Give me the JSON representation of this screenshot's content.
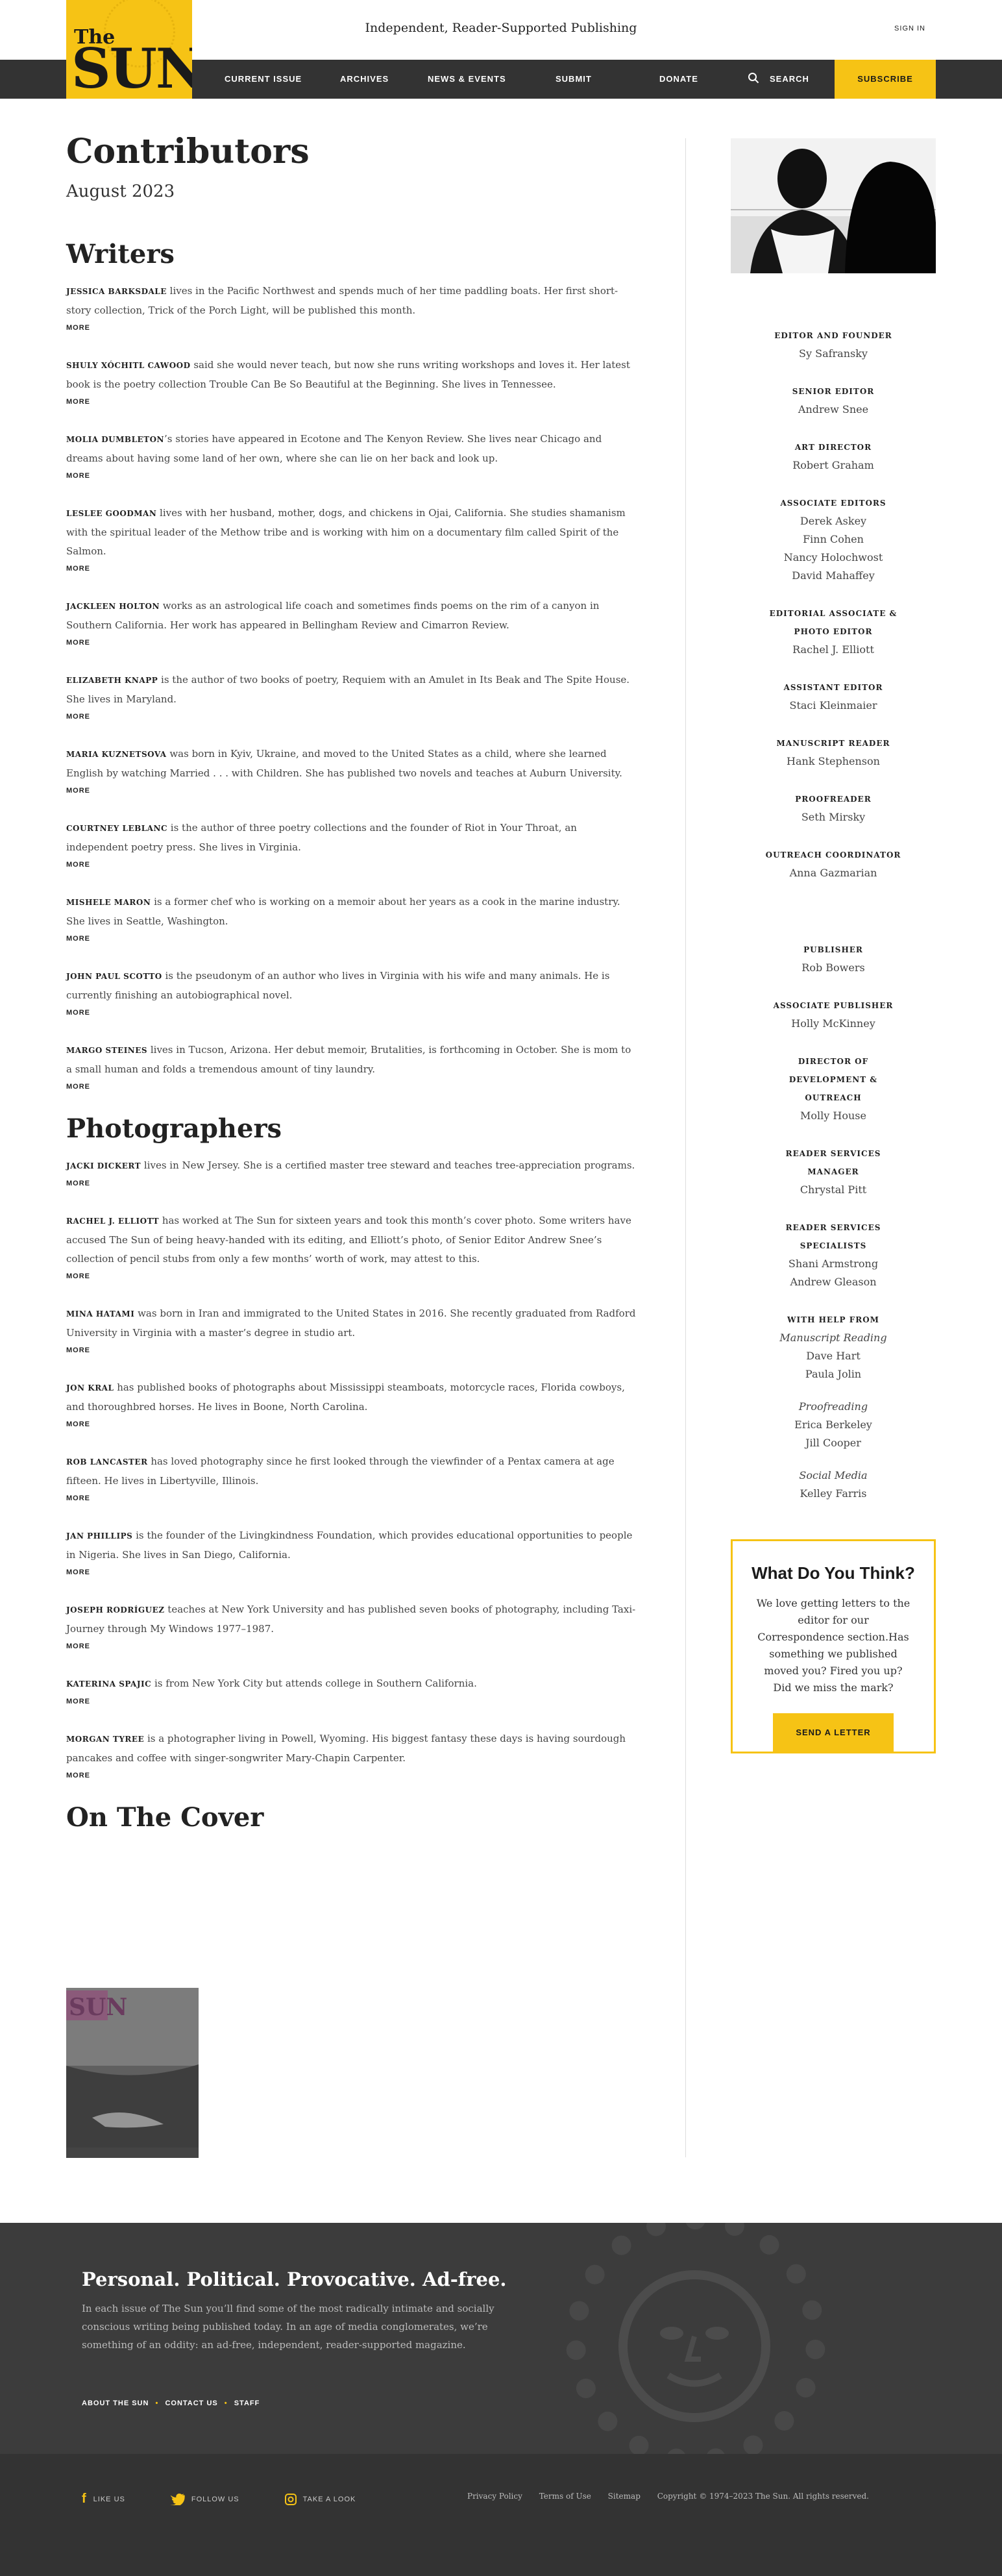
{
  "header": {
    "logo_the": "The",
    "logo_sun": "SUN",
    "tagline": "Independent, Reader-Supported Publishing",
    "signin": "SIGN IN"
  },
  "nav": {
    "items": [
      "CURRENT ISSUE",
      "ARCHIVES",
      "NEWS & EVENTS",
      "SUBMIT",
      "DONATE"
    ],
    "search": "SEARCH",
    "subscribe": "SUBSCRIBE"
  },
  "page": {
    "title": "Contributors",
    "issue": "August 2023",
    "writers_heading": "Writers",
    "photographers_heading": "Photographers",
    "cover_heading": "On The Cover",
    "more_label": "MORE"
  },
  "writers": [
    {
      "name": "JESSICA BARKSDALE",
      "text": " lives in the Pacific Northwest and spends much of her time paddling boats. Her first short-story collection, Trick of the Porch Light, will be published this month."
    },
    {
      "name": "SHULY XÓCHITL CAWOOD",
      "text": " said she would never teach, but now she runs writing workshops and loves it. Her latest book is the poetry collection Trouble Can Be So Beautiful at the Beginning. She lives in Tennessee."
    },
    {
      "name": "MOLIA DUMBLETON",
      "text": "’s stories have appeared in Ecotone and The Kenyon Review. She lives near Chicago and dreams about having some land of her own, where she can lie on her back and look up."
    },
    {
      "name": "LESLEE GOODMAN",
      "text": " lives with her husband, mother, dogs, and chickens in Ojai, California. She studies shamanism with the spiritual leader of the Methow tribe and is working with him on a documentary film called Spirit of the Salmon."
    },
    {
      "name": "JACKLEEN HOLTON",
      "text": " works as an astrological life coach and sometimes finds poems on the rim of a canyon in Southern California. Her work has appeared in Bellingham Review and Cimarron Review."
    },
    {
      "name": "ELIZABETH KNAPP",
      "text": " is the author of two books of poetry, Requiem with an Amulet in Its Beak and The Spite House. She lives in Maryland."
    },
    {
      "name": "MARIA KUZNETSOVA",
      "text": " was born in Kyiv, Ukraine, and moved to the United States as a child, where she learned English by watching Married . . . with Children. She has published two novels and teaches at Auburn University."
    },
    {
      "name": "COURTNEY LEBLANC",
      "text": " is the author of three poetry collections and the founder of Riot in Your Throat, an independent poetry press. She lives in Virginia."
    },
    {
      "name": "MISHELE MARON",
      "text": " is a former chef who is working on a memoir about her years as a cook in the marine industry. She lives in Seattle, Washington."
    },
    {
      "name": "JOHN PAUL SCOTTO",
      "text": " is the pseudonym of an author who lives in Virginia with his wife and many animals. He is currently finishing an autobiographical novel."
    },
    {
      "name": "MARGO STEINES",
      "text": " lives in Tucson, Arizona. Her debut memoir, Brutalities, is forthcoming in October. She is mom to a small human and folds a tremendous amount of tiny laundry."
    }
  ],
  "photographers": [
    {
      "name": "JACKI DICKERT",
      "text": " lives in New Jersey. She is a certified master tree steward and teaches tree-appreciation programs."
    },
    {
      "name": "RACHEL J. ELLIOTT",
      "text": " has worked at The Sun for sixteen years and took this month’s cover photo. Some writers have accused The Sun of being heavy-handed with its editing, and Elliott’s photo, of Senior Editor Andrew Snee’s collection of pencil stubs from only a few months’ worth of work, may attest to this."
    },
    {
      "name": "MINA HATAMI",
      "text": " was born in Iran and immigrated to the United States in 2016. She recently graduated from Radford University in Virginia with a master’s degree in studio art."
    },
    {
      "name": "JON KRAL",
      "text": " has published books of photographs about Mississippi steamboats, motorcycle races, Florida cowboys, and thoroughbred horses. He lives in Boone, North Carolina."
    },
    {
      "name": "ROB LANCASTER",
      "text": " has loved photography since he first looked through the viewfinder of a Pentax camera at age fifteen. He lives in Libertyville, Illinois."
    },
    {
      "name": "JAN PHILLIPS",
      "text": " is the founder of the Livingkindness Foundation, which provides educational opportunities to people in Nigeria. She lives in San Diego, California."
    },
    {
      "name": "JOSEPH RODRÍGUEZ",
      "text": " teaches at New York University and has published seven books of photography, including Taxi-Journey through My Windows 1977–1987."
    },
    {
      "name": "KATERINA SPAJIC",
      "text": " is from New York City but attends college in Southern California."
    },
    {
      "name": "MORGAN TYREE",
      "text": " is a photographer living in Powell, Wyoming. His biggest fantasy these days is having sourdough pancakes and coffee with singer-songwriter Mary-Chapin Carpenter."
    }
  ],
  "staff1": [
    {
      "role": "EDITOR AND FOUNDER",
      "names": [
        "Sy Safransky"
      ]
    },
    {
      "role": "SENIOR EDITOR",
      "names": [
        "Andrew Snee"
      ]
    },
    {
      "role": "ART DIRECTOR",
      "names": [
        "Robert Graham"
      ]
    },
    {
      "role": "ASSOCIATE EDITORS",
      "names": [
        "Derek Askey",
        "Finn Cohen",
        "Nancy Holochwost",
        "David Mahaffey"
      ]
    },
    {
      "role": "EDITORIAL ASSOCIATE & PHOTO EDITOR",
      "names": [
        "Rachel J. Elliott"
      ]
    },
    {
      "role": "ASSISTANT EDITOR",
      "names": [
        "Staci Kleinmaier"
      ]
    },
    {
      "role": "MANUSCRIPT READER",
      "names": [
        "Hank Stephenson"
      ]
    },
    {
      "role": "PROOFREADER",
      "names": [
        "Seth Mirsky"
      ]
    },
    {
      "role": "OUTREACH COORDINATOR",
      "names": [
        "Anna Gazmarian"
      ]
    }
  ],
  "staff2": [
    {
      "role": "PUBLISHER",
      "names": [
        "Rob Bowers"
      ]
    },
    {
      "role": "ASSOCIATE PUBLISHER",
      "names": [
        "Holly McKinney"
      ]
    },
    {
      "role": "DIRECTOR OF DEVELOPMENT & OUTREACH",
      "names": [
        "Molly House"
      ]
    },
    {
      "role": "READER SERVICES MANAGER",
      "names": [
        "Chrystal Pitt"
      ]
    },
    {
      "role": "READER SERVICES SPECIALISTS",
      "names": [
        "Shani Armstrong",
        "Andrew Gleason"
      ]
    }
  ],
  "help": {
    "role": "WITH HELP FROM",
    "groups": [
      {
        "label": "Manuscript Reading",
        "names": [
          "Dave Hart",
          "Paula Jolin"
        ]
      },
      {
        "label": "Proofreading",
        "names": [
          "Erica Berkeley",
          "Jill Cooper"
        ]
      },
      {
        "label": "Social Media",
        "names": [
          "Kelley Farris"
        ]
      }
    ]
  },
  "feedback": {
    "title": "What Do You Think?",
    "text": "We love getting letters to the editor for our Correspondence section.Has something we published moved you? Fired you up? Did we miss the mark?",
    "button": "SEND A LETTER"
  },
  "cover": {
    "logo": "SUN"
  },
  "footer": {
    "headline": "Personal. Political. Provocative. Ad-free.",
    "body": "In each issue of The Sun you’ll find some of the most radically intimate and socially conscious writing being published today. In an age of media conglomerates, we’re something of an oddity: an ad-free, independent, reader-supported magazine.",
    "links": [
      "ABOUT THE SUN",
      "CONTACT US",
      "STAFF"
    ],
    "social": [
      "LIKE US",
      "FOLLOW US",
      "TAKE A LOOK"
    ],
    "legal": [
      "Privacy Policy",
      "Terms of Use",
      "Sitemap"
    ],
    "copyright": "Copyright © 1974–2023 The Sun. All rights reserved.",
    "colors": {
      "brand": "#f6c315",
      "dark": "#333333"
    }
  }
}
